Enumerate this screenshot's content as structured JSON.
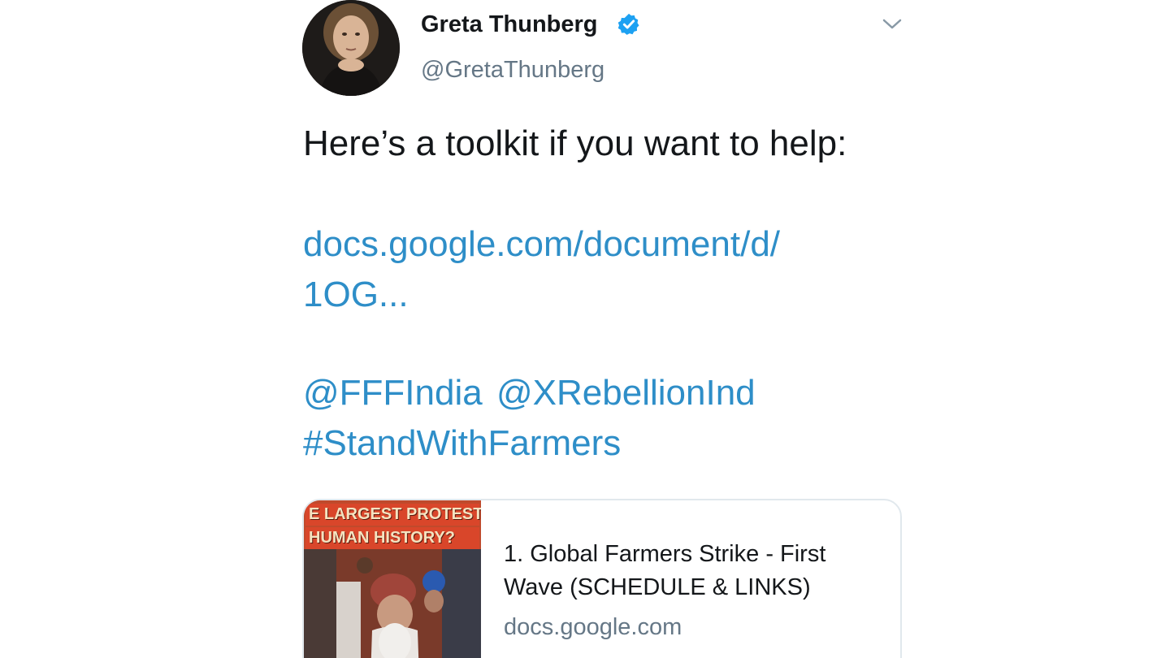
{
  "author": {
    "display_name": "Greta Thunberg",
    "handle": "@GretaThunberg",
    "verified": true,
    "verified_color": "#1da1f2"
  },
  "icons": {
    "verified": "verified-badge-icon",
    "menu": "chevron-down-icon"
  },
  "tweet": {
    "text": "Here’s a toolkit if you want to help:",
    "link_line_1": "docs.google.com/document/d/",
    "link_line_2": "1OG...",
    "mention_1": "@FFFIndia",
    "mention_2": "@XRebellionInd",
    "hashtag": "#StandWithFarmers",
    "link_color": "#2e8ec8"
  },
  "card": {
    "image_caption_line_1": "E LARGEST PROTEST",
    "image_caption_line_2": "HUMAN HISTORY?",
    "title": "1. Global Farmers Strike - First Wave (SCHEDULE & LINKS)",
    "domain": "docs.google.com"
  }
}
